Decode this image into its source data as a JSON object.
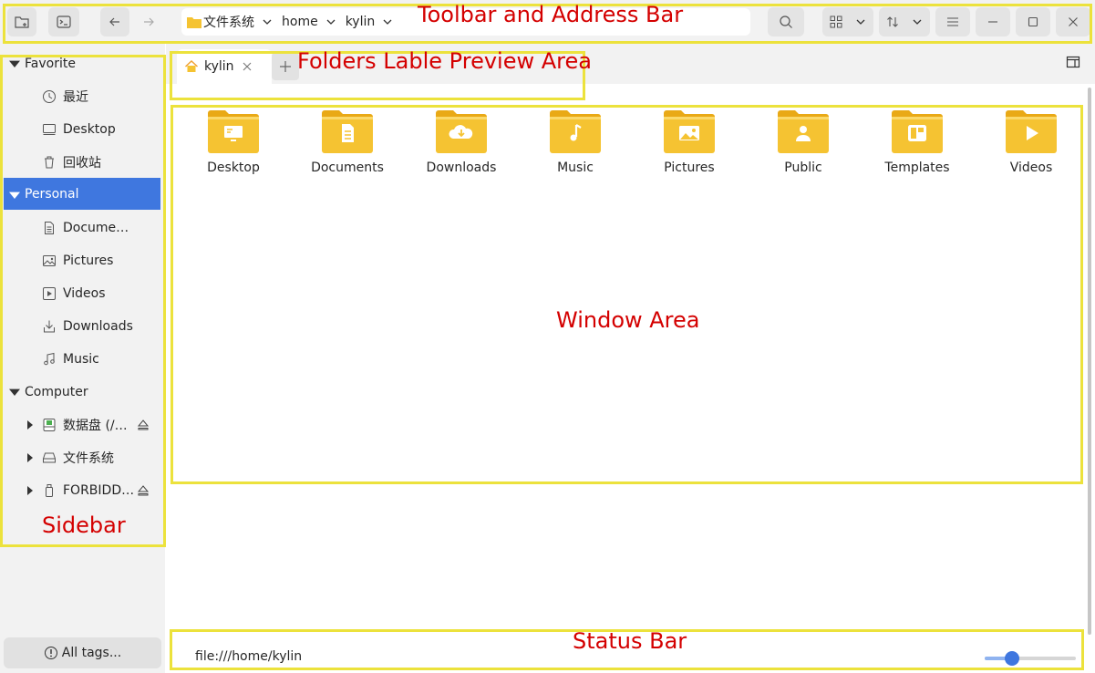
{
  "toolbar": {
    "address": {
      "crumbs": [
        "文件系统",
        "home",
        "kylin"
      ]
    }
  },
  "sidebar": {
    "sections": [
      {
        "label": "Favorite",
        "items": [
          "最近",
          "Desktop",
          "回收站"
        ]
      },
      {
        "label": "Personal",
        "items": [
          "Docume…",
          "Pictures",
          "Videos",
          "Downloads",
          "Music"
        ],
        "selected": true
      },
      {
        "label": "Computer",
        "items": [
          "数据盘 (/…",
          "文件系统",
          "FORBIDD…"
        ]
      }
    ],
    "all_tags": "All tags..."
  },
  "tabs": [
    {
      "label": "kylin",
      "icon": "home-icon"
    }
  ],
  "folders": [
    {
      "name": "Desktop",
      "icon": "monitor-icon"
    },
    {
      "name": "Documents",
      "icon": "document-icon"
    },
    {
      "name": "Downloads",
      "icon": "cloud-download-icon"
    },
    {
      "name": "Music",
      "icon": "music-note-icon"
    },
    {
      "name": "Pictures",
      "icon": "image-icon"
    },
    {
      "name": "Public",
      "icon": "person-icon"
    },
    {
      "name": "Templates",
      "icon": "template-icon"
    },
    {
      "name": "Videos",
      "icon": "play-icon"
    }
  ],
  "status": {
    "path": "file:///home/kylin",
    "zoom_fraction": 0.3
  },
  "annotations": {
    "toolbar": "Toolbar and Address Bar",
    "tabs": "Folders Lable Preview Area",
    "window": "Window Area",
    "sidebar": "Sidebar",
    "status": "Status Bar"
  },
  "colors": {
    "accent": "#3f77df",
    "folder": "#f5c332",
    "annotation_box": "#ece23c",
    "annotation_text": "#d40000"
  }
}
